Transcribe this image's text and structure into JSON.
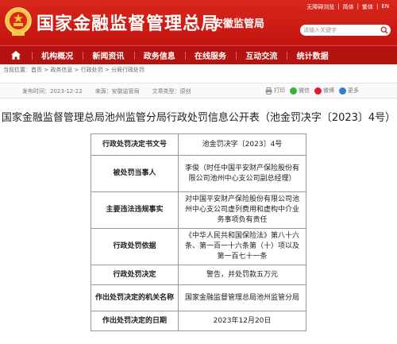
{
  "header": {
    "site_title": "国家金融监督管理总局",
    "branch_title": "安徽监管局",
    "top_links": [
      "无障碍浏览",
      "|",
      "简体",
      "|",
      "繁体",
      "|",
      "EN"
    ],
    "search_placeholder": "请输入关键字",
    "brand_color": "#c3140f"
  },
  "nav": {
    "home_icon": "home-icon",
    "items": [
      "机构概况",
      "新闻资讯",
      "政务信息",
      "在线服务",
      "互动交流",
      "统计数据"
    ]
  },
  "breadcrumb": {
    "prefix": "当前位置：",
    "items": [
      "首页",
      "政务信息",
      "行政处罚",
      "分局行政处罚"
    ],
    "separator": " > "
  },
  "meta": {
    "publish_time": "发布时间：2023-12-22",
    "source": "来源：安徽监管局",
    "doc_type": "文章类型：原创",
    "share": {
      "print": "打印",
      "wechat": "微信",
      "weibo": "微博",
      "more": "更多"
    }
  },
  "document": {
    "title": "国家金融监督管理总局池州监管分局行政处罚信息公开表（池金罚决字〔2023〕4号）",
    "rows": [
      {
        "key": "行政处罚决定书文号",
        "value": "池金罚决字〔2023〕4号"
      },
      {
        "key": "被处罚当事人",
        "value": "李俊（时任中国平安财产保险股份有限公司池州中心支公司副总经理）"
      },
      {
        "key": "主要违法违规事实",
        "value": "对中国平安财产保险股份有限公司池州中心支公司虚列费用和虚构中介业务事项负有责任"
      },
      {
        "key": "行政处罚依据",
        "value": "《中华人民共和国保险法》第八十六条、第一百一十六条第（十）项以及第一百七十一条"
      },
      {
        "key": "行政处罚决定",
        "value": "警告，并处罚款五万元"
      },
      {
        "key": "作出处罚决定的机关名称",
        "value": "国家金融监督管理总局池州监管分局"
      },
      {
        "key": "作出处罚决定的日期",
        "value": "2023年12月20日"
      }
    ]
  }
}
